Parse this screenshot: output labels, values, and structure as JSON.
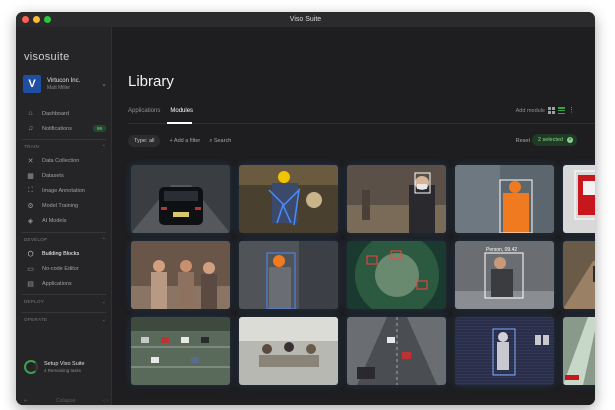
{
  "window": {
    "title": "Viso Suite"
  },
  "brand": "visosuite",
  "workspace": {
    "logo_letter": "V",
    "name": "Virtucon Inc.",
    "user": "Matt Miller"
  },
  "nav": {
    "main": [
      {
        "label": "Dashboard",
        "icon": "home-icon"
      },
      {
        "label": "Notifications",
        "icon": "bell-icon",
        "badge": "99"
      }
    ],
    "train_label": "TRAIN",
    "train": [
      {
        "label": "Data Collection",
        "icon": "collect-icon"
      },
      {
        "label": "Datasets",
        "icon": "dataset-icon"
      },
      {
        "label": "Image Annotation",
        "icon": "annotation-icon"
      },
      {
        "label": "Model Training",
        "icon": "training-icon"
      },
      {
        "label": "AI Models",
        "icon": "model-icon"
      }
    ],
    "develop_label": "DEVELOP",
    "develop": [
      {
        "label": "Building Blocks",
        "icon": "cube-icon",
        "active": true
      },
      {
        "label": "No-code Editor",
        "icon": "editor-icon"
      },
      {
        "label": "Applications",
        "icon": "apps-icon"
      }
    ],
    "deploy_label": "DEPLOY",
    "operate_label": "OPERATE"
  },
  "setup": {
    "title": "Setup Viso Suite",
    "subtitle": "4 Remaining tasks"
  },
  "collapse_label": "Collapse",
  "main": {
    "title": "Library",
    "tabs": [
      {
        "label": "Applications"
      },
      {
        "label": "Modules",
        "active": true
      }
    ],
    "add_module": "Add module",
    "filters": {
      "type": "Type: all",
      "add_filter": "Add a filter",
      "search": "Search"
    },
    "reset": "Reset",
    "selected": "2 selected"
  },
  "annotations": {
    "person_label": "Person, 09.42"
  },
  "colors": {
    "accent": "#3da04a",
    "window_bg": "#1c1c1e",
    "sidebar_bg": "#252527"
  }
}
